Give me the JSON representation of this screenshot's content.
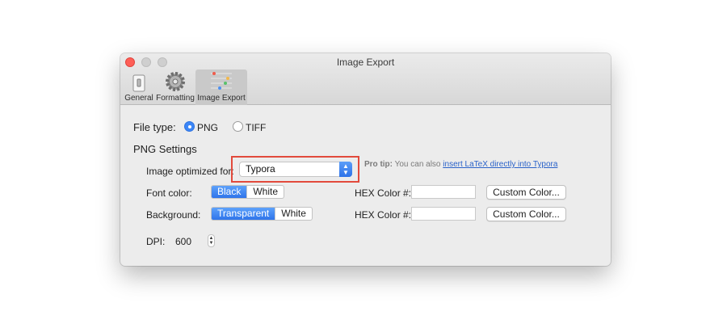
{
  "window": {
    "title": "Image Export"
  },
  "toolbar": {
    "items": [
      {
        "label": "General",
        "icon": "switch-icon"
      },
      {
        "label": "Formatting",
        "icon": "gear-icon"
      },
      {
        "label": "Image Export",
        "icon": "sliders-icon"
      }
    ],
    "selected": "Image Export"
  },
  "file_type": {
    "label": "File type:",
    "options": [
      "PNG",
      "TIFF"
    ],
    "selected": "PNG"
  },
  "png_settings": {
    "title": "PNG Settings",
    "optimized_label": "Image optimized for:",
    "optimized_value": "Typora",
    "pro_tip_bold": "Pro tip:",
    "pro_tip_text": " You can also ",
    "pro_tip_link": "insert LaTeX directly into Typora",
    "font_color": {
      "label": "Font color:",
      "options": [
        "Black",
        "White"
      ],
      "selected": "Black",
      "hex_label": "HEX Color #:",
      "hex_value": "",
      "custom_button": "Custom Color..."
    },
    "background": {
      "label": "Background:",
      "options": [
        "Transparent",
        "White"
      ],
      "selected": "Transparent",
      "hex_label": "HEX Color #:",
      "hex_value": "",
      "custom_button": "Custom Color..."
    },
    "dpi": {
      "label": "DPI:",
      "value": "600"
    }
  },
  "colors": {
    "accent": "#3b86f7",
    "highlight": "#e24a3c"
  }
}
